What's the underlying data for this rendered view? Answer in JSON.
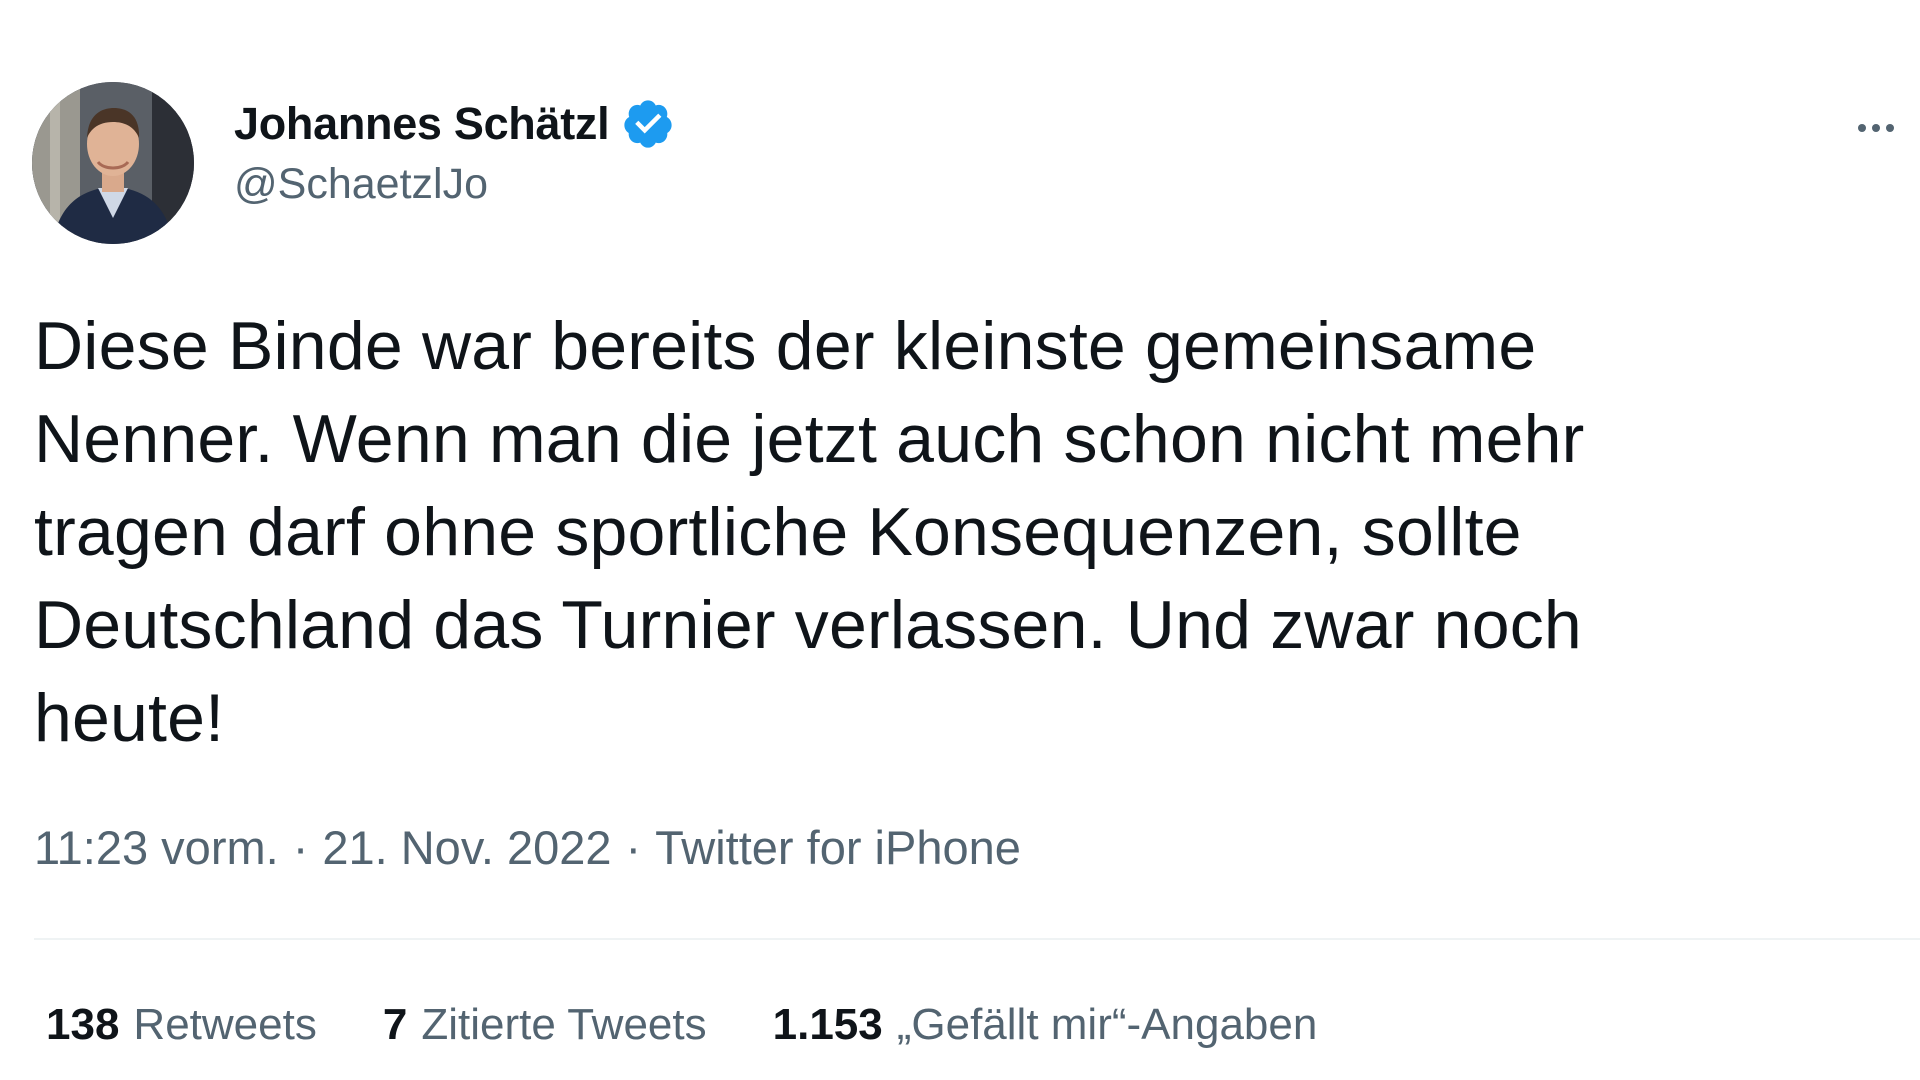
{
  "author": {
    "display_name": "Johannes Schätzl",
    "handle": "@SchaetzlJo",
    "verified": true,
    "badge_color": "#1d9bf0"
  },
  "tweet": {
    "text": "Diese Binde war bereits der kleinste gemeinsame\nNenner. Wenn man die jetzt auch schon nicht mehr\ntragen darf ohne sportliche Konsequenzen, sollte\nDeutschland das Turnier verlassen. Und zwar noch\nheute!",
    "time": "11:23 vorm.",
    "separator": "·",
    "date": "21. Nov. 2022",
    "source": "Twitter for iPhone"
  },
  "stats": {
    "retweets": {
      "count": "138",
      "label": "Retweets"
    },
    "quotes": {
      "count": "7",
      "label": "Zitierte Tweets"
    },
    "likes": {
      "count": "1.153",
      "label": "„Gefällt mir“-Angaben"
    }
  },
  "icons": {
    "more": "more-horizontal-icon",
    "verified": "verified-badge-icon"
  },
  "colors": {
    "text_primary": "#0f1419",
    "text_secondary": "#536471",
    "divider": "#eff3f4",
    "accent": "#1d9bf0"
  }
}
